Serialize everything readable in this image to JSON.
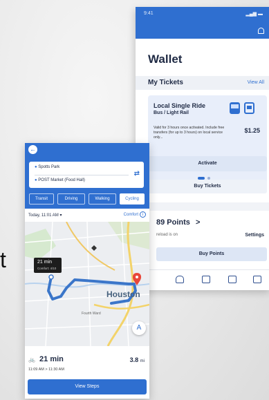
{
  "stray_glyph": "t",
  "wallet": {
    "status_time": "9:41",
    "status_icons": "▂▄▆ ▬",
    "title": "Wallet",
    "tickets_header": "My Tickets",
    "view_all": "View All",
    "ticket": {
      "name": "Local Single Ride",
      "type": "Bus / Light Rail",
      "description": "Valid for 3 hours once activated. Include free transfers (for up to 3 hours) on local service only...",
      "price": "$1.25",
      "activate_label": "Activate"
    },
    "buy_tickets_label": "Buy Tickets",
    "points_label": "89 Points",
    "points_chevron": ">",
    "reload_text": "reload is on",
    "settings_label": "Settings",
    "buy_points_label": "Buy Points",
    "accent": "#2f6fd0"
  },
  "trip": {
    "back_icon": "←",
    "origin": "Spotts Park",
    "destination": "POST Market (Food Hall)",
    "swap_icon": "⇄",
    "modes": [
      {
        "label": "Transit",
        "selected": false
      },
      {
        "label": "Driving",
        "selected": false
      },
      {
        "label": "Walking",
        "selected": false
      },
      {
        "label": "Cycling",
        "selected": true
      }
    ],
    "depart_text": "Today, 11:01 AM ▾",
    "comfort_label": "Comfort",
    "info_icon": "i",
    "map": {
      "bubble_time": "21 min",
      "bubble_sub": "Comfort: 4/10",
      "city_label": "Houston",
      "fourth_ward_label": "Fourth Ward",
      "nav_icon": "A"
    },
    "duration": "21 min",
    "bike_icon": "🚲",
    "distance": "3.8",
    "distance_unit": "mi",
    "time_range": "11:09 AM  >  11:30 AM",
    "view_steps_label": "View Steps"
  }
}
